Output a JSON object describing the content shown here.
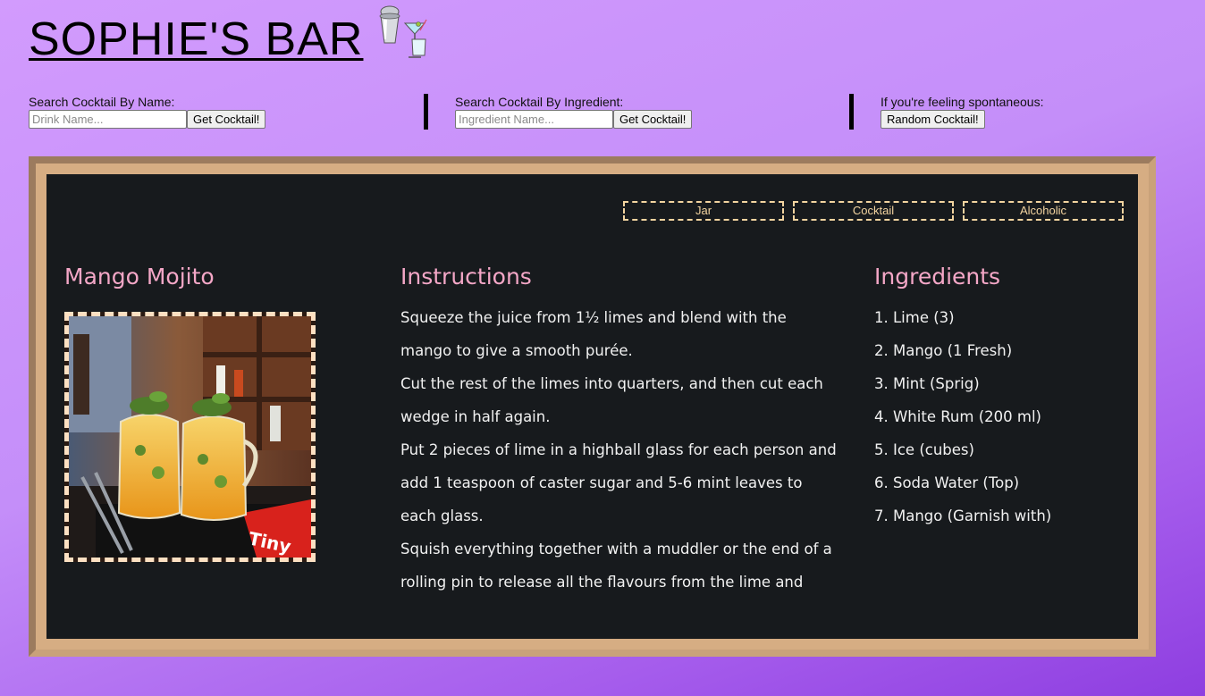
{
  "header": {
    "title": "SOPHIE'S BAR",
    "logo_icon": "cocktail-shaker-icon"
  },
  "search_by_name": {
    "label": "Search Cocktail By Name:",
    "placeholder": "Drink Name...",
    "button": "Get Cocktail!"
  },
  "search_by_ingredient": {
    "label": "Search Cocktail By Ingredient:",
    "placeholder": "Ingredient Name...",
    "button": "Get Cocktail!"
  },
  "random": {
    "label": "If you're feeling spontaneous:",
    "button": "Random Cocktail!"
  },
  "drink": {
    "tags": [
      "Jar",
      "Cocktail",
      "Alcoholic"
    ],
    "name": "Mango Mojito",
    "instructions_heading": "Instructions",
    "instructions": [
      "Squeeze the juice from 1½ limes and blend with the mango to give a smooth purée.",
      "Cut the rest of the limes into quarters, and then cut each wedge in half again.",
      "Put 2 pieces of lime in a highball glass for each person and add 1 teaspoon of caster sugar and 5-6 mint leaves to each glass.",
      "Squish everything together with a muddler or the end of a rolling pin to release all the flavours from the lime and"
    ],
    "ingredients_heading": "Ingredients",
    "ingredients": [
      "1. Lime (3)",
      "2. Mango (1 Fresh)",
      "3. Mint (Sprig)",
      "4. White Rum (200 ml)",
      "5. Ice (cubes)",
      "6. Soda Water (Top)",
      "7. Mango (Garnish with)"
    ]
  },
  "colors": {
    "background_top": "#d29bfd",
    "background_bottom": "#8e3ee0",
    "frame": "#d6ad83",
    "board": "#171a1d",
    "heading": "#f4a7c7",
    "tag": "#f3d4a0"
  }
}
